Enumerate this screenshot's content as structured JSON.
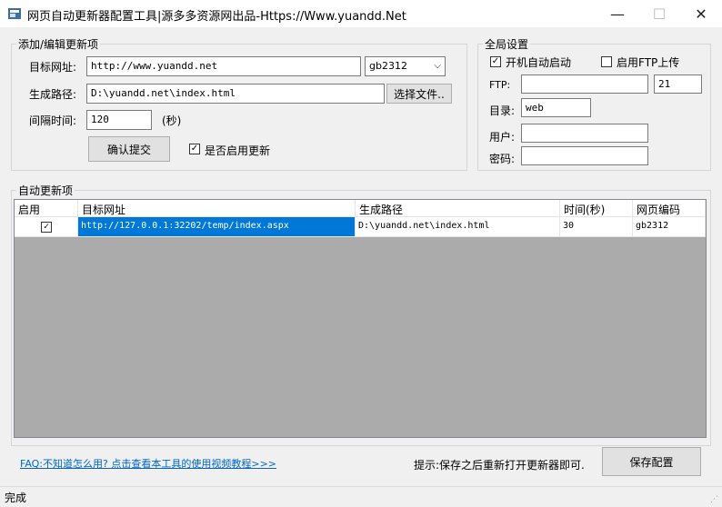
{
  "window": {
    "title": "网页自动更新器配置工具|源多多资源网出品-Https://Www.yuandd.Net",
    "minimize_glyph": "—",
    "maximize_glyph": "☐",
    "close_glyph": "✕"
  },
  "add_group": {
    "title": "添加/编辑更新项",
    "url_label": "目标网址:",
    "url_value": "http://www.yuandd.net",
    "encoding_value": "gb2312",
    "path_label": "生成路径:",
    "path_value": "D:\\yuandd.net\\index.html",
    "browse_button": "选择文件..",
    "interval_label": "间隔时间:",
    "interval_value": "120",
    "interval_unit": "(秒)",
    "submit_button": "确认提交",
    "enable_update_label": "是否启用更新",
    "enable_update_checked": true
  },
  "global_group": {
    "title": "全局设置",
    "autostart_label": "开机自动启动",
    "autostart_checked": true,
    "ftp_upload_label": "启用FTP上传",
    "ftp_upload_checked": false,
    "ftp_label": "FTP:",
    "ftp_host_value": "",
    "ftp_port_value": "21",
    "dir_label": "目录:",
    "dir_value": "web",
    "user_label": "用户:",
    "user_value": "",
    "password_label": "密码:",
    "password_value": ""
  },
  "list_group": {
    "title": "自动更新项",
    "columns": [
      "启用",
      "目标网址",
      "生成路径",
      "时间(秒)",
      "网页编码"
    ],
    "rows": [
      {
        "enabled": true,
        "url": "http://127.0.0.1:32202/temp/index.aspx",
        "path": "D:\\yuandd.net\\index.html",
        "interval": "30",
        "encoding": "gb2312"
      }
    ]
  },
  "footer": {
    "faq_link": "FAQ:不知道怎么用? 点击查看本工具的使用视频教程>>>",
    "hint": "提示:保存之后重新打开更新器即可.",
    "save_button": "保存配置"
  },
  "status": {
    "text": "完成"
  },
  "colors": {
    "selection": "#0078d7",
    "grid_background": "#ababab",
    "link": "#0066cc"
  }
}
